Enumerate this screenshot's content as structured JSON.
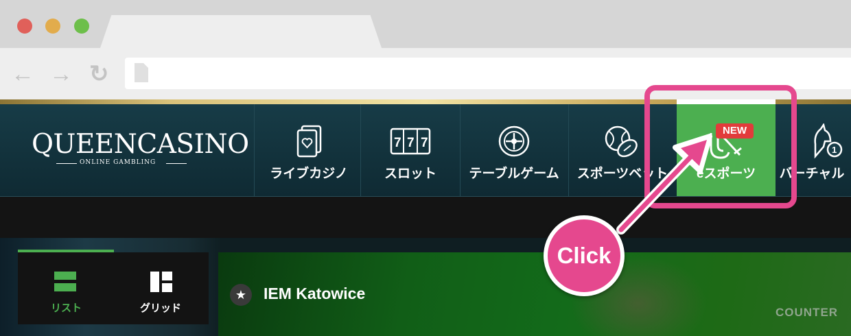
{
  "site": {
    "logo": {
      "name": "QUEENCASINO",
      "tagline": "ONLINE GAMBLING"
    },
    "nav_items": [
      {
        "label": "ライブカジノ",
        "icon": "playing-card-heart-icon"
      },
      {
        "label": "スロット",
        "icon": "slot-machine-777-icon",
        "icon_text": "777"
      },
      {
        "label": "テーブルゲーム",
        "icon": "roulette-wheel-icon"
      },
      {
        "label": "スポーツベット",
        "icon": "sports-balls-icon"
      },
      {
        "label": "eスポーツ",
        "icon": "esports-helmet-sword-icon",
        "badge": "NEW",
        "active": true
      },
      {
        "label": "バーチャル",
        "icon": "virtual-horse-icon"
      }
    ]
  },
  "view_toggle": {
    "list_label": "リスト",
    "grid_label": "グリッド",
    "active": "list"
  },
  "event": {
    "title": "IEM Katowice"
  },
  "banner_text": "COUNTER",
  "annotation": {
    "text": "Click"
  },
  "colors": {
    "nav_bg": "#173c47",
    "esports_active": "#4caf50",
    "badge": "#e23b3b",
    "annotation_pink": "#e5488e"
  }
}
